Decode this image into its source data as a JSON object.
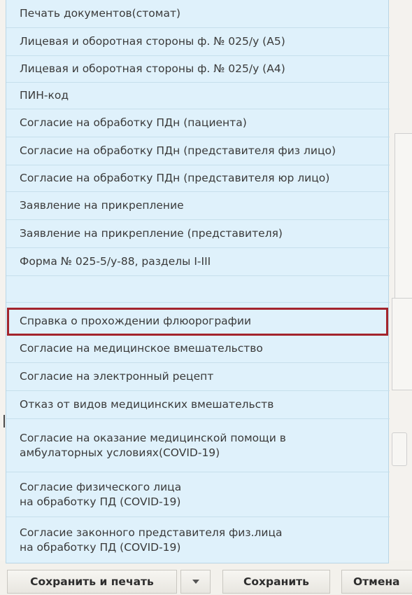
{
  "menu": {
    "items": [
      {
        "label": "Печать документов(стомат)"
      },
      {
        "label": "Лицевая и оборотная стороны ф. № 025/у (А5)"
      },
      {
        "label": "Лицевая и оборотная стороны ф. № 025/у (А4)"
      },
      {
        "label": "ПИН-код"
      },
      {
        "label": "Согласие на обработку ПДн (пациента)"
      },
      {
        "label": "Согласие на обработку ПДн (представителя физ лицо)"
      },
      {
        "label": "Согласие на обработку ПДн (представителя юр лицо)"
      },
      {
        "label": "Заявление на прикрепление"
      },
      {
        "label": "Заявление на прикрепление (представителя)"
      },
      {
        "label": "Форма № 025-5/у-88, разделы I-III"
      },
      {
        "label": "Справка о прохождении флюорографии"
      },
      {
        "label": "Согласие на медицинское вмешательство"
      },
      {
        "label": "Согласие на электронный рецепт"
      },
      {
        "label": "Отказ от видов медицинских вмешательств"
      },
      {
        "label": "Согласие на оказание медицинской помощи в\nамбулаторных условиях(COVID-19)"
      },
      {
        "label": "Согласие физического лица\nна обработку ПД (COVID-19)"
      },
      {
        "label": "Согласие законного представителя физ.лица\nна обработку ПД (COVID-19)"
      }
    ],
    "highlighted_item": "Справка о прохождении флюорографии",
    "highlight_color": "#a3242c",
    "background_color": "#dff1fb"
  },
  "toolbar": {
    "save_print_label": "Сохранить и печать",
    "dropdown_icon": "chevron-down-icon",
    "save_label": "Сохранить",
    "cancel_label": "Отмена"
  }
}
